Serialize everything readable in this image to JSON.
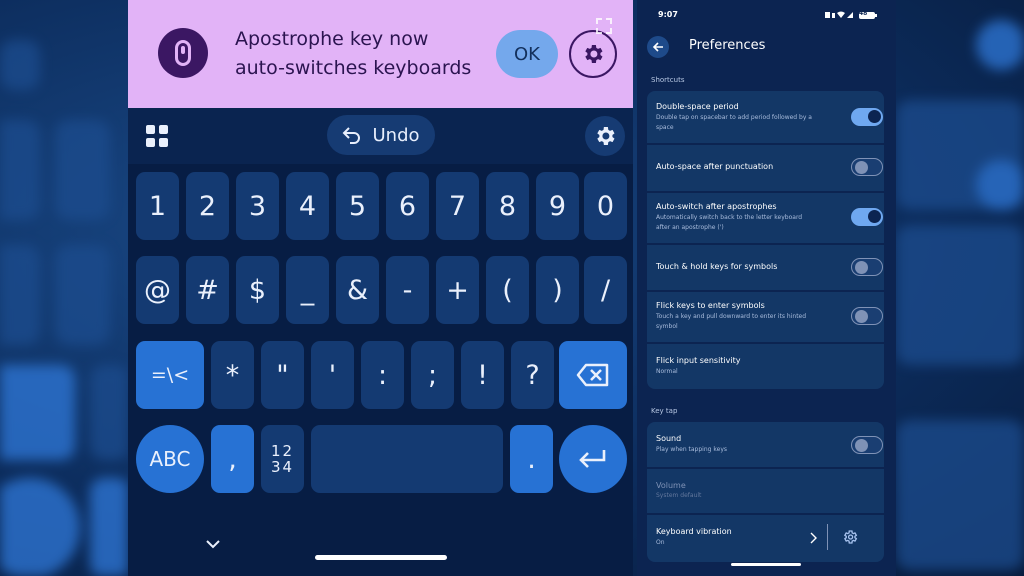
{
  "colors": {
    "banner": "#e2b3f7",
    "keyboard_bg": "#071d44",
    "key": "#143a72",
    "key_accent": "#2772d4",
    "settings_bg": "#0c2451",
    "card": "#133766",
    "toggle_on": "#6fa8f0"
  },
  "banner": {
    "icon": "keyboard-switch-icon",
    "line1": "Apostrophe key now",
    "line2": "auto-switches keyboards",
    "ok_label": "OK",
    "settings_icon": "gear-icon"
  },
  "toolbar": {
    "apps_icon": "grid-icon",
    "undo_label": "Undo",
    "settings_icon": "gear-icon"
  },
  "keyboard": {
    "row1": [
      "1",
      "2",
      "3",
      "4",
      "5",
      "6",
      "7",
      "8",
      "9",
      "0"
    ],
    "row2": [
      "@",
      "#",
      "$",
      "_",
      "&",
      "-",
      "+",
      "(",
      ")",
      "/"
    ],
    "row3": {
      "switch_label": "=\\<",
      "keys": [
        "*",
        "\"",
        "'",
        ":",
        ";",
        "!",
        "?"
      ],
      "delete_icon": "backspace-icon"
    },
    "row4": {
      "abc_label": "ABC",
      "comma": ",",
      "numpad_line1": "12",
      "numpad_line2": "34",
      "period": ".",
      "enter_icon": "enter-icon"
    },
    "hide_icon": "chevron-down-icon"
  },
  "settings": {
    "status_time": "9:07",
    "battery": "48",
    "title": "Preferences",
    "sections": {
      "shortcuts": "Shortcuts",
      "key_tap": "Key tap"
    },
    "items": [
      {
        "title": "Double-space period",
        "subtitle": "Double tap on spacebar to add period followed by a space",
        "toggle": "on"
      },
      {
        "title": "Auto-space after punctuation",
        "subtitle": "",
        "toggle": "off"
      },
      {
        "title": "Auto-switch after apostrophes",
        "subtitle": "Automatically switch back to the letter keyboard after an apostrophe (')",
        "toggle": "on"
      },
      {
        "title": "Touch & hold keys for symbols",
        "subtitle": "",
        "toggle": "off"
      },
      {
        "title": "Flick keys to enter symbols",
        "subtitle": "Touch a key and pull downward to enter its hinted symbol",
        "toggle": "off"
      },
      {
        "title": "Flick input sensitivity",
        "subtitle": "Normal",
        "toggle": "none"
      }
    ],
    "key_tap_items": [
      {
        "title": "Sound",
        "subtitle": "Play when tapping keys",
        "toggle": "off"
      },
      {
        "title": "Volume",
        "subtitle": "System default",
        "toggle": "none"
      },
      {
        "title": "Keyboard vibration",
        "subtitle": "On",
        "toggle": "none"
      }
    ]
  }
}
